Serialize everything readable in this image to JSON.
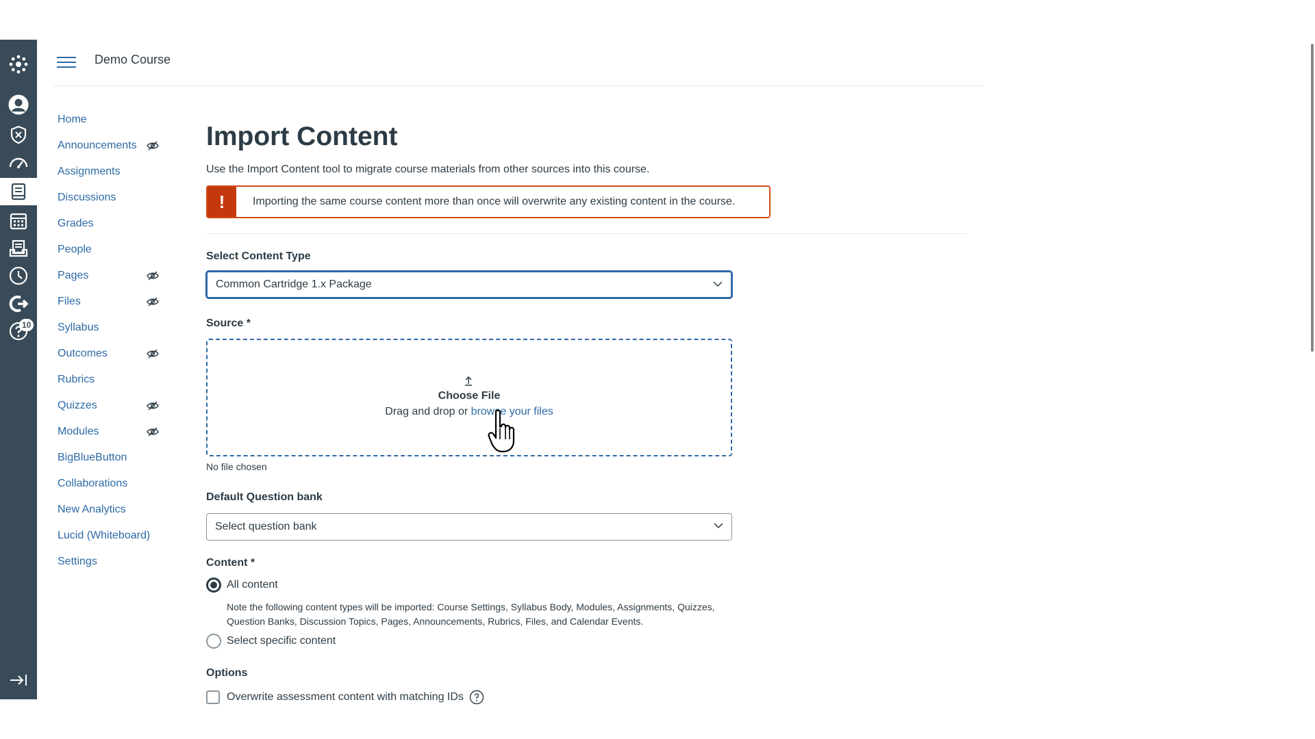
{
  "global_nav": {
    "items": [
      {
        "icon": "canvas-logo-icon",
        "active": false
      },
      {
        "icon": "account-icon",
        "active": false
      },
      {
        "icon": "admin-shield-icon",
        "active": false
      },
      {
        "icon": "dashboard-icon",
        "active": false
      },
      {
        "icon": "courses-icon",
        "active": true
      },
      {
        "icon": "calendar-icon",
        "active": false
      },
      {
        "icon": "inbox-icon",
        "active": false
      },
      {
        "icon": "history-icon",
        "active": false
      },
      {
        "icon": "commons-icon",
        "active": false
      },
      {
        "icon": "help-icon",
        "active": false,
        "badge": "10"
      }
    ],
    "collapse_icon": "collapse-nav-icon"
  },
  "header": {
    "course_title": "Demo Course"
  },
  "course_nav": {
    "items": [
      {
        "label": "Home",
        "hidden": false
      },
      {
        "label": "Announcements",
        "hidden": true
      },
      {
        "label": "Assignments",
        "hidden": false
      },
      {
        "label": "Discussions",
        "hidden": false
      },
      {
        "label": "Grades",
        "hidden": false
      },
      {
        "label": "People",
        "hidden": false
      },
      {
        "label": "Pages",
        "hidden": true
      },
      {
        "label": "Files",
        "hidden": true
      },
      {
        "label": "Syllabus",
        "hidden": false
      },
      {
        "label": "Outcomes",
        "hidden": true
      },
      {
        "label": "Rubrics",
        "hidden": false
      },
      {
        "label": "Quizzes",
        "hidden": true
      },
      {
        "label": "Modules",
        "hidden": true
      },
      {
        "label": "BigBlueButton",
        "hidden": false
      },
      {
        "label": "Collaborations",
        "hidden": false
      },
      {
        "label": "New Analytics",
        "hidden": false
      },
      {
        "label": "Lucid (Whiteboard)",
        "hidden": false
      },
      {
        "label": "Settings",
        "hidden": false
      }
    ]
  },
  "main": {
    "title": "Import Content",
    "intro": "Use the Import Content tool to migrate course materials from other sources into this course.",
    "alert": {
      "icon_text": "!",
      "message": "Importing the same course content more than once will overwrite any existing content in the course."
    },
    "content_type": {
      "label": "Select Content Type",
      "value": "Common Cartridge 1.x Package"
    },
    "source": {
      "label": "Source *",
      "choose_file": "Choose File",
      "drag_text": "Drag and drop or ",
      "browse_link": "browse your files",
      "no_file": "No file chosen"
    },
    "question_bank": {
      "label": "Default Question bank",
      "value": "Select question bank"
    },
    "content": {
      "label": "Content *",
      "all_content": "All content",
      "note": "Note the following content types will be imported: Course Settings, Syllabus Body, Modules, Assignments, Quizzes, Question Banks, Discussion Topics, Pages, Announcements, Rubrics, Files, and Calendar Events.",
      "specific_content": "Select specific content",
      "selected": "All content"
    },
    "options": {
      "label": "Options",
      "overwrite_label": "Overwrite assessment content with matching IDs",
      "overwrite_checked": false
    }
  },
  "colors": {
    "global_nav_bg": "#394b58",
    "link": "#2d6aa6",
    "alert_border": "#d24b19",
    "alert_icon_bg": "#c4390c",
    "text": "#2d3b45"
  }
}
